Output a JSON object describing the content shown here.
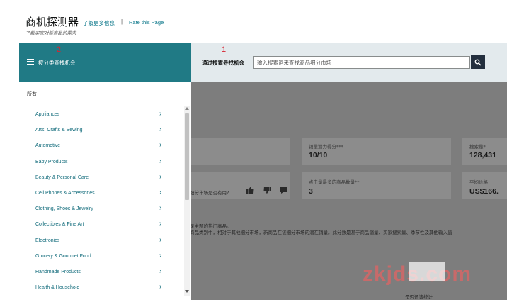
{
  "header": {
    "title": "商机探测器",
    "learn_more": "了解更多信息",
    "separator": "|",
    "rate_link": "Rate this Page",
    "subtitle": "了解买家对新商品的需求"
  },
  "search": {
    "badge": "1",
    "label": "通过搜索寻找机会",
    "placeholder": "输入搜索词来查找商品细分市场"
  },
  "sidebar": {
    "badge": "2",
    "head_label": "按分类查找机会",
    "all_label": "所有",
    "categories": [
      "Appliances",
      "Arts, Crafts & Sewing",
      "Automotive",
      "Baby Products",
      "Beauty & Personal Care",
      "Cell Phones & Accessories",
      "Clothing, Shoes & Jewelry",
      "Collectibles & Fine Art",
      "Electronics",
      "Grocery & Gourmet Food",
      "Handmade Products",
      "Health & Household"
    ],
    "chevron": "›"
  },
  "background": {
    "card1_label": "销量潜力得分***",
    "card1_value": "10/10",
    "card2_label": "搜索量*",
    "card2_value": "128,431",
    "card3_label": "点击量最多的商品数量**",
    "card3_value": "3",
    "card4_label": "平均价格",
    "card4_value": "US$166.",
    "feedback_question": "细分市场是否有用?",
    "text_line1": "录主题的热门商品。",
    "text_line2": "商品类别中，相对于其他细分市场，新商品在该细分市场的潜在销量。此分数是基于商品销量、买家搜索量、季节性及其他输入值",
    "bottom_text": "是否还该统计",
    "watermark": "zkjds.com"
  },
  "colors": {
    "sidebar_head": "#207a85",
    "search_btn": "#232f3e",
    "link": "#007185",
    "badge": "#d7232f"
  }
}
